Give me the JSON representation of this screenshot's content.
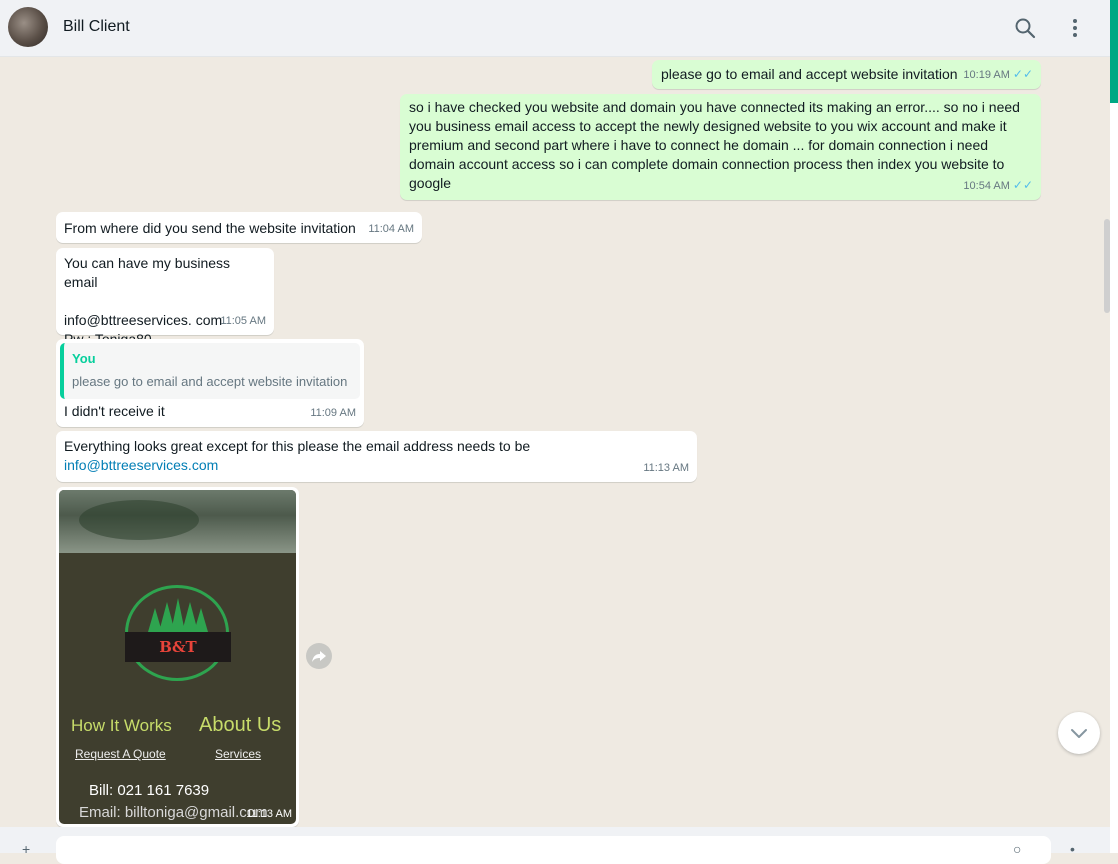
{
  "header": {
    "contact_name": "Bill Client",
    "icons": [
      "avatar",
      "search-icon",
      "menu-icon"
    ]
  },
  "messages": [
    {
      "dir": "out",
      "text": "please go to email and accept website invitation",
      "time": "10:19 AM",
      "status": "read"
    },
    {
      "dir": "out",
      "text": "so i have checked you website and domain you have connected its making an error.... so no i need you business email access to accept the newly designed website to you wix account and make it premium and second part where i have to connect he domain ... for domain connection i need domain account access so i can complete domain connection process then index you website to google",
      "time": "10:54 AM",
      "status": "read"
    },
    {
      "dir": "in",
      "text": "From where did you send the website invitation",
      "time": "11:04 AM"
    },
    {
      "dir": "in",
      "text": "You can have my business email\n\ninfo@bttreeservices. com\nPw : Toniga80",
      "time": "11:05 AM"
    },
    {
      "dir": "in",
      "quote": {
        "author": "You",
        "text": "please go to email and accept website invitation"
      },
      "text": "I didn't receive it",
      "time": "11:09 AM"
    },
    {
      "dir": "in",
      "text": "Everything looks great except for this please the email address needs to be",
      "link": "info@bttreeservices.com",
      "time": "11:13 AM"
    },
    {
      "dir": "in",
      "type": "image",
      "time": "11:13 AM",
      "image": {
        "logo_text": "B&T",
        "nav_left": "How It Works",
        "nav_right": "About Us",
        "link_left": "Request A Quote",
        "link_right": "Services",
        "contact_phone": "Bill: 021 161 7639",
        "contact_email": "Email: billtoniga@gmail.com"
      }
    }
  ],
  "colors": {
    "outgoing": "#d9fdd3",
    "incoming": "#ffffff",
    "accent": "#00a884",
    "read_ticks": "#53bdeb",
    "chat_bg": "#efeae2"
  },
  "footer": {
    "input_placeholder": ""
  }
}
